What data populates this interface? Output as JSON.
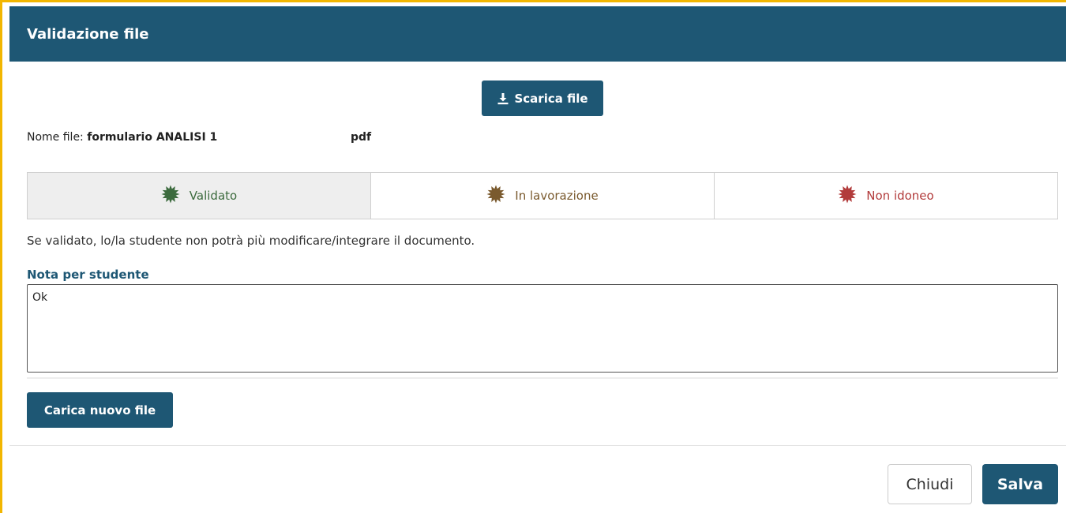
{
  "modal": {
    "title": "Validazione file"
  },
  "download": {
    "icon": "download-icon",
    "label": "Scarica file"
  },
  "file": {
    "label": "Nome file: ",
    "name": "formulario ANALISI 1",
    "extension": "pdf"
  },
  "status": {
    "options": [
      {
        "label": "Validato",
        "icon": "badge-icon",
        "color": "#3c6b3e",
        "selected": true
      },
      {
        "label": "In lavorazione",
        "icon": "badge-icon",
        "color": "#7a5a2e",
        "selected": false
      },
      {
        "label": "Non idoneo",
        "icon": "badge-icon",
        "color": "#b23b3b",
        "selected": false
      }
    ]
  },
  "warning": "Se validato, lo/la studente non potrà più modificare/integrare il documento.",
  "note": {
    "label": "Nota per studente",
    "value": "Ok"
  },
  "upload": {
    "label": "Carica nuovo file"
  },
  "footer": {
    "close_label": "Chiudi",
    "save_label": "Salva"
  },
  "colors": {
    "primary": "#1e5774",
    "accent_border": "#f2b600"
  }
}
